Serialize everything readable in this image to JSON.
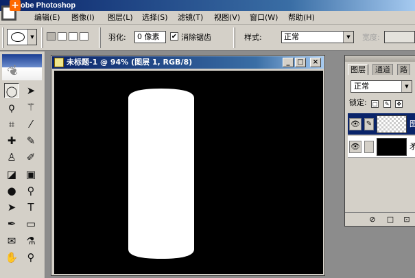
{
  "app": {
    "title": "obe Photoshop",
    "overlay_icon": "+"
  },
  "menu": [
    {
      "label": "编辑(E)"
    },
    {
      "label": "图像(I)"
    },
    {
      "label": "图层(L)"
    },
    {
      "label": "选择(S)"
    },
    {
      "label": "滤镜(T)"
    },
    {
      "label": "视图(V)"
    },
    {
      "label": "窗口(W)"
    },
    {
      "label": "帮助(H)"
    }
  ],
  "options": {
    "tool_preset_icon": "ellipse-marquee-icon",
    "feather_label": "羽化:",
    "feather_value": "0 像素",
    "antialias_check": "✔",
    "antialias_label": "消除锯齿",
    "style_label": "样式:",
    "style_value": "正常",
    "width_label": "宽度:"
  },
  "toolbox": {
    "tools": [
      {
        "name": "elliptical-marquee-icon",
        "glyph": "◯"
      },
      {
        "name": "move-icon",
        "glyph": "➤"
      },
      {
        "name": "lasso-icon",
        "glyph": "ϙ"
      },
      {
        "name": "magic-wand-icon",
        "glyph": "⚚"
      },
      {
        "name": "crop-icon",
        "glyph": "⌗"
      },
      {
        "name": "slice-icon",
        "glyph": "⁄"
      },
      {
        "name": "healing-brush-icon",
        "glyph": "✚"
      },
      {
        "name": "brush-icon",
        "glyph": "✎"
      },
      {
        "name": "clone-stamp-icon",
        "glyph": "♙"
      },
      {
        "name": "history-brush-icon",
        "glyph": "✐"
      },
      {
        "name": "eraser-icon",
        "glyph": "◪"
      },
      {
        "name": "gradient-icon",
        "glyph": "▣"
      },
      {
        "name": "blur-icon",
        "glyph": "●"
      },
      {
        "name": "dodge-icon",
        "glyph": "⚲"
      },
      {
        "name": "path-selection-icon",
        "glyph": "➤"
      },
      {
        "name": "type-icon",
        "glyph": "T"
      },
      {
        "name": "pen-icon",
        "glyph": "✒"
      },
      {
        "name": "rectangle-icon",
        "glyph": "▭"
      },
      {
        "name": "notes-icon",
        "glyph": "✉"
      },
      {
        "name": "eyedropper-icon",
        "glyph": "⚗"
      },
      {
        "name": "hand-icon",
        "glyph": "✋"
      },
      {
        "name": "zoom-icon",
        "glyph": "⚲"
      }
    ]
  },
  "document": {
    "title": "未标题-1 @ 94% (图层 1, RGB/8)",
    "min": "_",
    "max": "□",
    "close": "×"
  },
  "layers": {
    "tabs": [
      {
        "label": "图层"
      },
      {
        "label": "通道"
      },
      {
        "label": "路"
      }
    ],
    "blend_mode": "正常",
    "lock_label": "锁定:",
    "lock_icons": [
      "□",
      "✎",
      "✥"
    ],
    "rows": [
      {
        "name": "图",
        "eye": "👁",
        "link": "✎",
        "thumb": "checker",
        "selected": true
      },
      {
        "name": "矛",
        "eye": "👁",
        "link": "",
        "thumb": "black",
        "selected": false
      }
    ],
    "bottom_buttons": [
      "⊘",
      "□",
      "⊡"
    ]
  },
  "colors": {
    "title_blue": "#0a246a",
    "panel_gray": "#d4d0c8",
    "canvas_bg": "#000000",
    "shape_fill": "#ffffff"
  }
}
